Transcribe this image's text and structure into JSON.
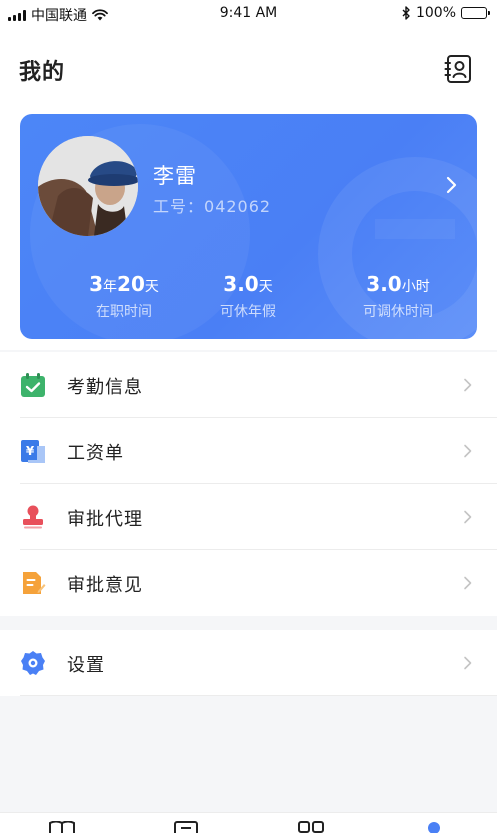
{
  "status_bar": {
    "carrier": "中国联通",
    "time": "9:41 AM",
    "battery": "100%",
    "battery_level": 1.0
  },
  "header": {
    "title": "我的",
    "contacts_icon": "contacts-book-icon"
  },
  "profile": {
    "name": "李雷",
    "emp_id_label": "工号：",
    "emp_id": "042062",
    "stats": [
      {
        "value_parts": [
          {
            "num": "3"
          },
          {
            "unit": "年"
          },
          {
            "num": "20"
          },
          {
            "unit": "天"
          }
        ],
        "label": "在职时间"
      },
      {
        "value_parts": [
          {
            "num": "3.0"
          },
          {
            "unit": "天"
          }
        ],
        "label": "可休年假"
      },
      {
        "value_parts": [
          {
            "num": "3.0"
          },
          {
            "unit": "小时"
          }
        ],
        "label": "可调休时间"
      }
    ]
  },
  "menu": {
    "items": [
      {
        "label": "考勤信息",
        "icon": "calendar-check-icon"
      },
      {
        "label": "工资单",
        "icon": "payslip-yen-icon"
      },
      {
        "label": "审批代理",
        "icon": "stamp-icon"
      },
      {
        "label": "审批意见",
        "icon": "document-edit-icon"
      }
    ],
    "settings": {
      "label": "设置",
      "icon": "gear-icon"
    }
  },
  "tab_bar": {
    "icons": [
      "book-icon",
      "list-icon",
      "grid-icon",
      "profile-dot-icon"
    ],
    "active_index": 3
  },
  "colors": {
    "accent": "#4a80f5",
    "calendar_icon": "#3db36b",
    "payslip_icon": "#3a7ae8",
    "stamp_icon": "#e8505b",
    "document_icon": "#f5a23a",
    "gear_icon": "#4a80f5"
  }
}
